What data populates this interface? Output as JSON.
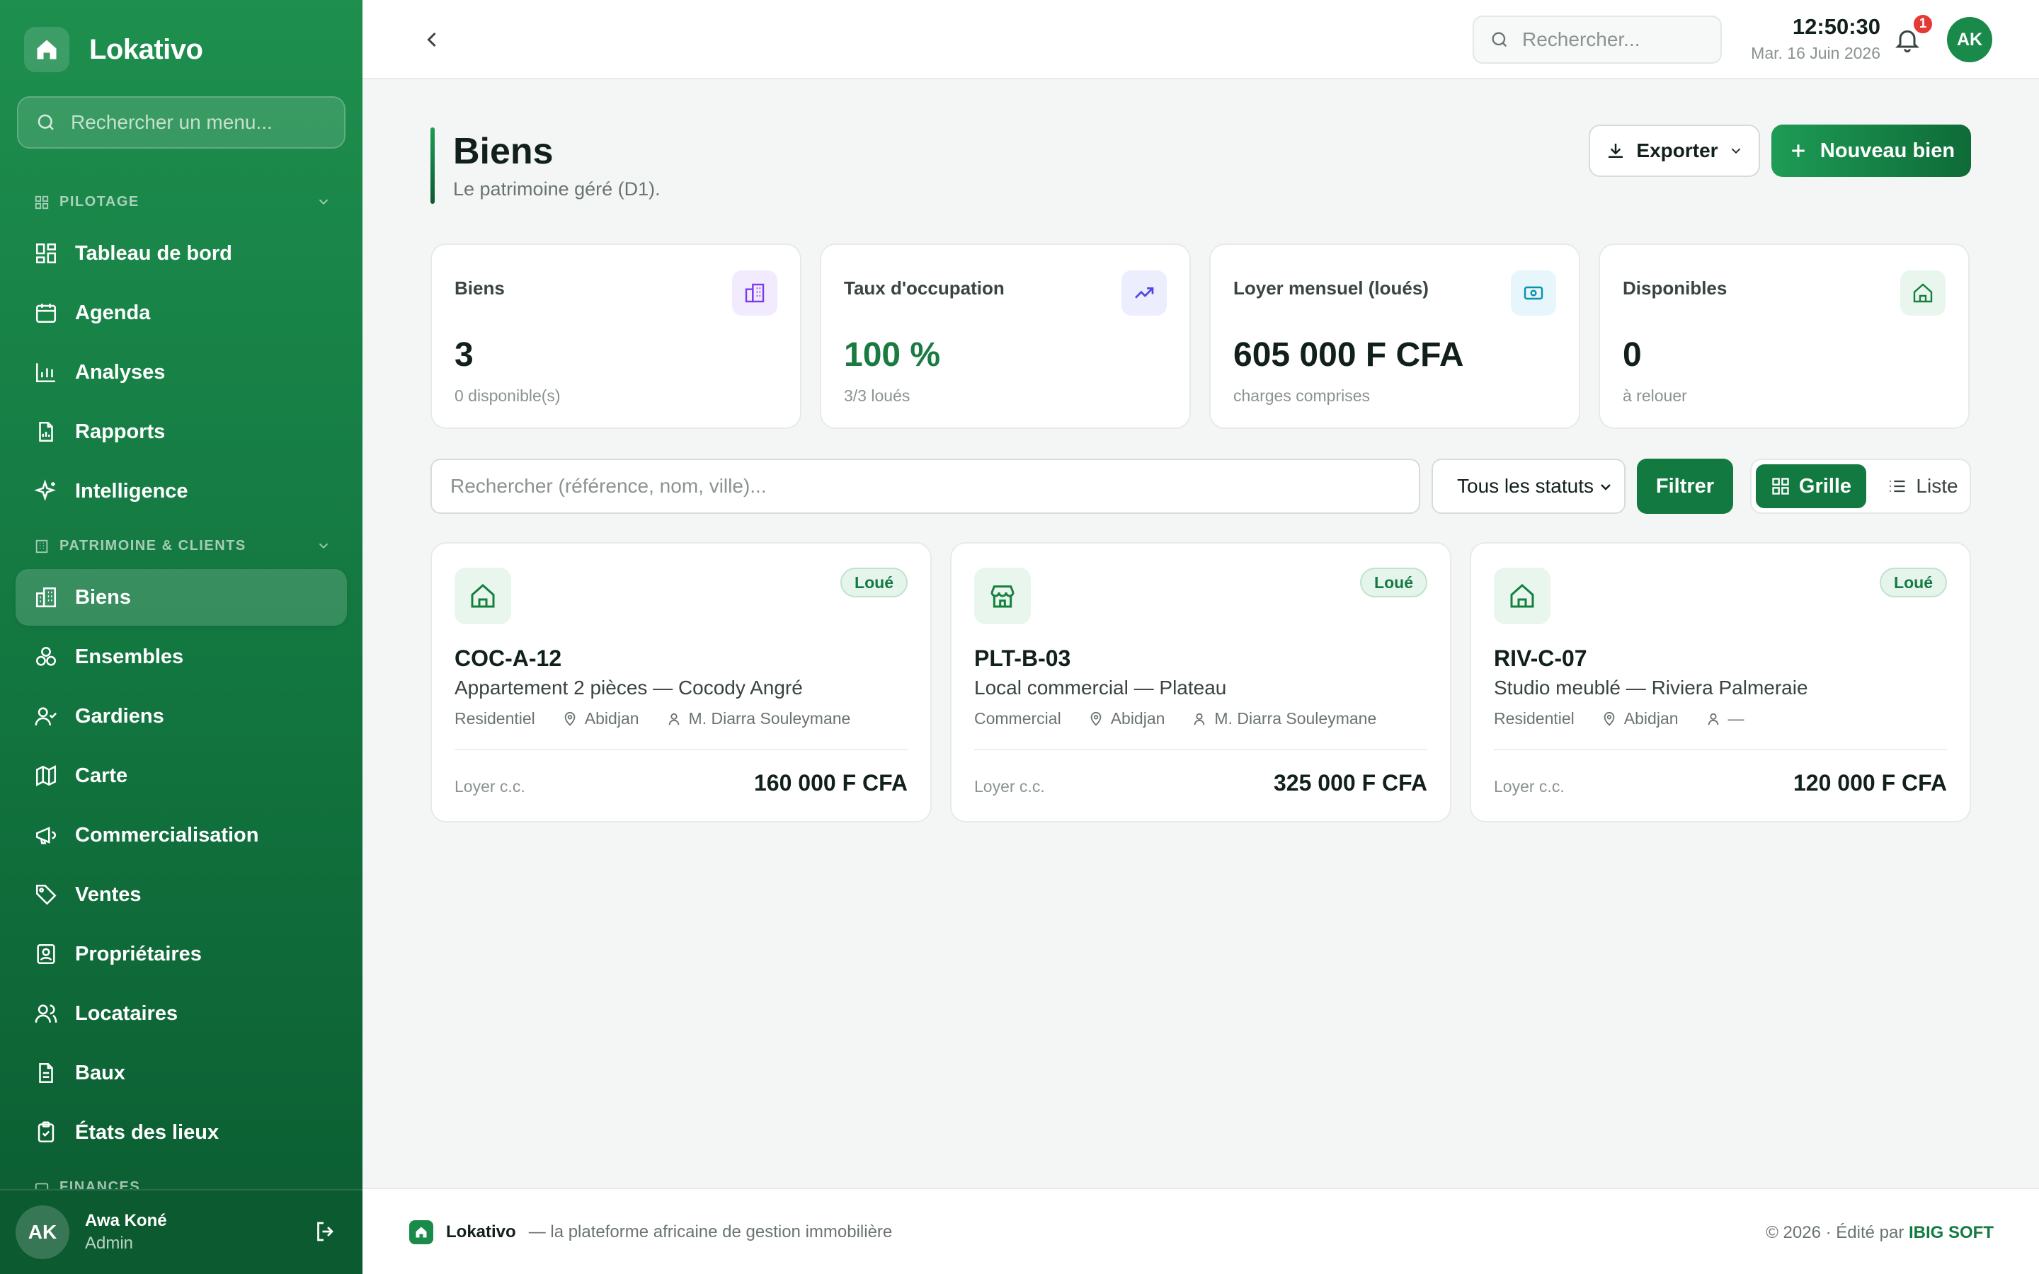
{
  "app": {
    "name": "Lokativo"
  },
  "sidebar": {
    "search_placeholder": "Rechercher un menu...",
    "sections": [
      {
        "label": "PILOTAGE"
      },
      {
        "label": "PATRIMOINE & CLIENTS"
      },
      {
        "label": "FINANCES"
      }
    ],
    "items": [
      {
        "label": "Tableau de bord",
        "icon": "dashboard-icon"
      },
      {
        "label": "Agenda",
        "icon": "calendar-icon"
      },
      {
        "label": "Analyses",
        "icon": "bar-chart-icon"
      },
      {
        "label": "Rapports",
        "icon": "report-icon"
      },
      {
        "label": "Intelligence",
        "icon": "sparkles-icon"
      },
      {
        "label": "Biens",
        "icon": "building-icon",
        "active": true
      },
      {
        "label": "Ensembles",
        "icon": "boxes-icon"
      },
      {
        "label": "Gardiens",
        "icon": "user-check-icon"
      },
      {
        "label": "Carte",
        "icon": "map-icon"
      },
      {
        "label": "Commercialisation",
        "icon": "megaphone-icon"
      },
      {
        "label": "Ventes",
        "icon": "tag-icon"
      },
      {
        "label": "Propriétaires",
        "icon": "contact-icon"
      },
      {
        "label": "Locataires",
        "icon": "users-icon"
      },
      {
        "label": "Baux",
        "icon": "document-icon"
      },
      {
        "label": "États des lieux",
        "icon": "clipboard-icon"
      }
    ],
    "user": {
      "initials": "AK",
      "name": "Awa Koné",
      "role": "Admin"
    }
  },
  "topbar": {
    "search_placeholder": "Rechercher...",
    "time": "12:50:30",
    "date": "Mar. 16 Juin 2026",
    "notifications": "1",
    "avatar_initials": "AK"
  },
  "page": {
    "title": "Biens",
    "subtitle": "Le patrimoine géré (D1).",
    "export_label": "Exporter",
    "new_label": "Nouveau bien"
  },
  "stats": [
    {
      "label": "Biens",
      "value": "3",
      "sub": "0 disponible(s)",
      "icon": "building-icon",
      "accent": "#7c3aed"
    },
    {
      "label": "Taux d'occupation",
      "value": "100 %",
      "sub": "3/3 loués",
      "icon": "trending-up-icon",
      "accent": "#4f46e5"
    },
    {
      "label": "Loyer mensuel (loués)",
      "value": "605 000 F CFA",
      "sub": "charges comprises",
      "icon": "banknote-icon",
      "accent": "#0891b2"
    },
    {
      "label": "Disponibles",
      "value": "0",
      "sub": "à relouer",
      "icon": "home-icon",
      "accent": "#15803d"
    }
  ],
  "filters": {
    "search_placeholder": "Rechercher (référence, nom, ville)...",
    "status_value": "Tous les statuts",
    "filter_label": "Filtrer",
    "view_grid": "Grille",
    "view_list": "Liste"
  },
  "properties": [
    {
      "ref": "COC-A-12",
      "name": "Appartement 2 pièces — Cocody Angré",
      "type": "Residentiel",
      "city": "Abidjan",
      "manager": "M. Diarra Souleymane",
      "status": "Loué",
      "rent_label": "Loyer c.c.",
      "rent": "160 000 F CFA",
      "icon": "home-icon"
    },
    {
      "ref": "PLT-B-03",
      "name": "Local commercial — Plateau",
      "type": "Commercial",
      "city": "Abidjan",
      "manager": "M. Diarra Souleymane",
      "status": "Loué",
      "rent_label": "Loyer c.c.",
      "rent": "325 000 F CFA",
      "icon": "store-icon"
    },
    {
      "ref": "RIV-C-07",
      "name": "Studio meublé — Riviera Palmeraie",
      "type": "Residentiel",
      "city": "Abidjan",
      "manager": "—",
      "status": "Loué",
      "rent_label": "Loyer c.c.",
      "rent": "120 000 F CFA",
      "icon": "home-icon"
    }
  ],
  "footer": {
    "brand": "Lokativo",
    "tagline": "— la plateforme africaine de gestion immobilière",
    "copyright": "© 2026 · Édité par",
    "editor": "IBIG SOFT"
  }
}
